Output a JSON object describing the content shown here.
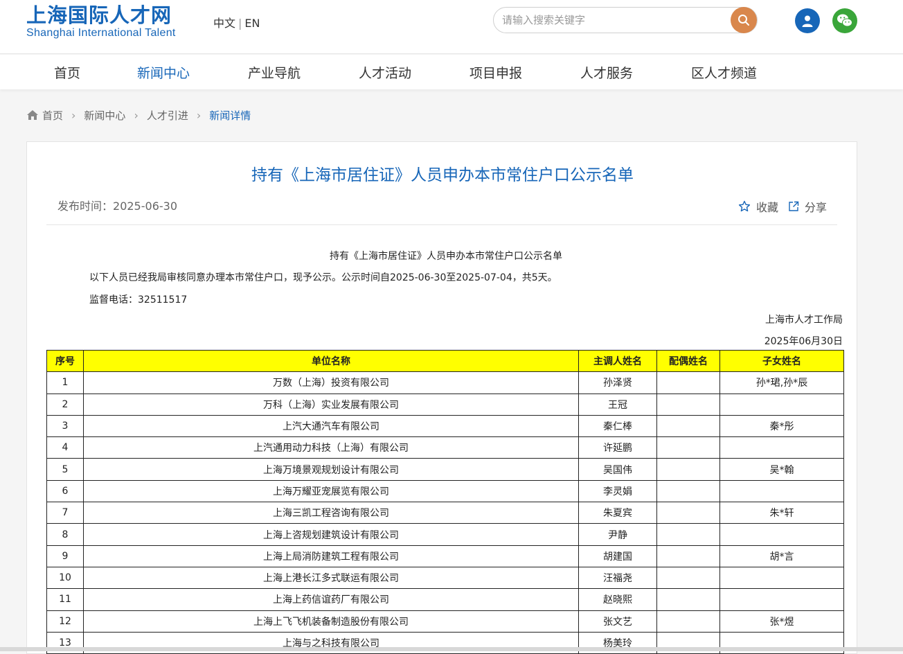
{
  "header": {
    "logo_cn": "上海国际人才网",
    "logo_en": "Shanghai International Talent",
    "lang_cn": "中文",
    "lang_sep": "|",
    "lang_en": "EN",
    "search_placeholder": "请输入搜索关键字"
  },
  "nav": {
    "items": [
      {
        "label": "首页"
      },
      {
        "label": "新闻中心"
      },
      {
        "label": "产业导航"
      },
      {
        "label": "人才活动"
      },
      {
        "label": "项目申报"
      },
      {
        "label": "人才服务"
      },
      {
        "label": "区人才频道"
      }
    ],
    "active": "新闻中心"
  },
  "breadcrumb": [
    "首页",
    "新闻中心",
    "人才引进",
    "新闻详情"
  ],
  "article": {
    "title": "持有《上海市居住证》人员申办本市常住户口公示名单",
    "publish_label": "发布时间：",
    "publish_date": "2025-06-30",
    "favorite_label": "收藏",
    "share_label": "分享",
    "doc_title": "持有《上海市居住证》人员申办本市常住户口公示名单",
    "doc_p1": "以下人员已经我局审核同意办理本市常住户口，现予公示。公示时间自2025-06-30至2025-07-04，共5天。",
    "doc_p2": "监督电话：32511517",
    "doc_org": "上海市人才工作局",
    "doc_date": "2025年06月30日"
  },
  "table": {
    "headers": [
      "序号",
      "单位名称",
      "主调人姓名",
      "配偶姓名",
      "子女姓名"
    ],
    "rows": [
      [
        "1",
        "万数（上海）投资有限公司",
        "孙泽贤",
        "",
        "孙*珺,孙*辰"
      ],
      [
        "2",
        "万科（上海）实业发展有限公司",
        "王冠",
        "",
        ""
      ],
      [
        "3",
        "上汽大通汽车有限公司",
        "秦仁棒",
        "",
        "秦*彤"
      ],
      [
        "4",
        "上汽通用动力科技（上海）有限公司",
        "许延鹏",
        "",
        ""
      ],
      [
        "5",
        "上海万境景观规划设计有限公司",
        "吴国伟",
        "",
        "吴*翰"
      ],
      [
        "6",
        "上海万耀亚宠展览有限公司",
        "李灵娟",
        "",
        ""
      ],
      [
        "7",
        "上海三凯工程咨询有限公司",
        "朱夏宾",
        "",
        "朱*轩"
      ],
      [
        "8",
        "上海上咨规划建筑设计有限公司",
        "尹静",
        "",
        ""
      ],
      [
        "9",
        "上海上局消防建筑工程有限公司",
        "胡建国",
        "",
        "胡*言"
      ],
      [
        "10",
        "上海上港长江多式联运有限公司",
        "汪福尧",
        "",
        ""
      ],
      [
        "11",
        "上海上药信谊药厂有限公司",
        "赵晓熙",
        "",
        ""
      ],
      [
        "12",
        "上海上飞飞机装备制造股份有限公司",
        "张文艺",
        "",
        "张*煜"
      ],
      [
        "13",
        "上海与之科技有限公司",
        "杨美玲",
        "",
        ""
      ]
    ]
  },
  "colors": {
    "brand": "#1766b8",
    "search_button": "#d9874c",
    "wechat": "#3aa63a",
    "table_header_bg": "#ffff00"
  },
  "icons": [
    "search-icon",
    "user-icon",
    "wechat-icon",
    "home-icon",
    "star-icon",
    "share-icon"
  ]
}
